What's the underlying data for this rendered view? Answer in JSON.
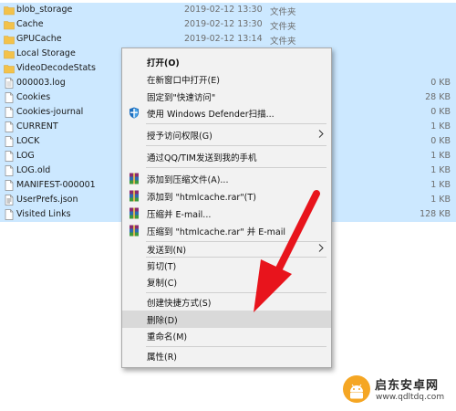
{
  "files": [
    {
      "name": "blob_storage",
      "icon": "folder-icon",
      "date": "2019-02-12 13:30",
      "type": "文件夹",
      "size": ""
    },
    {
      "name": "Cache",
      "icon": "folder-icon",
      "date": "2019-02-12 13:30",
      "type": "文件夹",
      "size": ""
    },
    {
      "name": "GPUCache",
      "icon": "folder-icon",
      "date": "2019-02-12 13:14",
      "type": "文件夹",
      "size": ""
    },
    {
      "name": "Local Storage",
      "icon": "folder-icon",
      "date": "",
      "type": "",
      "size": ""
    },
    {
      "name": "VideoDecodeStats",
      "icon": "folder-icon",
      "date": "",
      "type": "",
      "size": ""
    },
    {
      "name": "000003.log",
      "icon": "file-icon",
      "date": "",
      "type": "",
      "size": "0 KB"
    },
    {
      "name": "Cookies",
      "icon": "file-icon",
      "date": "",
      "type": "",
      "size": "28 KB"
    },
    {
      "name": "Cookies-journal",
      "icon": "file-icon",
      "date": "",
      "type": "",
      "size": "0 KB"
    },
    {
      "name": "CURRENT",
      "icon": "file-icon",
      "date": "",
      "type": "",
      "size": "1 KB"
    },
    {
      "name": "LOCK",
      "icon": "file-icon",
      "date": "",
      "type": "",
      "size": "0 KB"
    },
    {
      "name": "LOG",
      "icon": "file-icon",
      "date": "",
      "type": "",
      "size": "1 KB"
    },
    {
      "name": "LOG.old",
      "icon": "file-icon",
      "date": "",
      "type": "",
      "size": "1 KB"
    },
    {
      "name": "MANIFEST-000001",
      "icon": "file-icon",
      "date": "",
      "type": "",
      "size": "1 KB"
    },
    {
      "name": "UserPrefs.json",
      "icon": "json-file-icon",
      "date": "",
      "type": "",
      "size": "1 KB"
    },
    {
      "name": "Visited Links",
      "icon": "file-icon",
      "date": "",
      "type": "",
      "size": "128 KB"
    }
  ],
  "context_menu": {
    "open": "打开(O)",
    "open_new_window": "在新窗口中打开(E)",
    "pin_quick_access": "固定到\"快速访问\"",
    "defender_scan": "使用 Windows Defender扫描...",
    "grant_access": "授予访问权限(G)",
    "send_qq_tim": "通过QQ/TIM发送到我的手机",
    "add_archive": "添加到压缩文件(A)...",
    "add_htmlcache_rar": "添加到 \"htmlcache.rar\"(T)",
    "compress_email": "压缩并 E-mail...",
    "compress_htmlcache_email": "压缩到 \"htmlcache.rar\" 并 E-mail",
    "send_to": "发送到(N)",
    "cut": "剪切(T)",
    "copy": "复制(C)",
    "create_shortcut": "创建快捷方式(S)",
    "delete": "删除(D)",
    "rename": "重命名(M)",
    "properties": "属性(R)"
  },
  "watermark": {
    "title": "启东安卓网",
    "url": "www.qdltdq.com"
  },
  "colors": {
    "selection": "#cce8ff",
    "menu_bg": "#f2f2f2",
    "menu_highlight": "#d9d9d9",
    "arrow": "#e8141c",
    "folder": "#f3c24a"
  }
}
